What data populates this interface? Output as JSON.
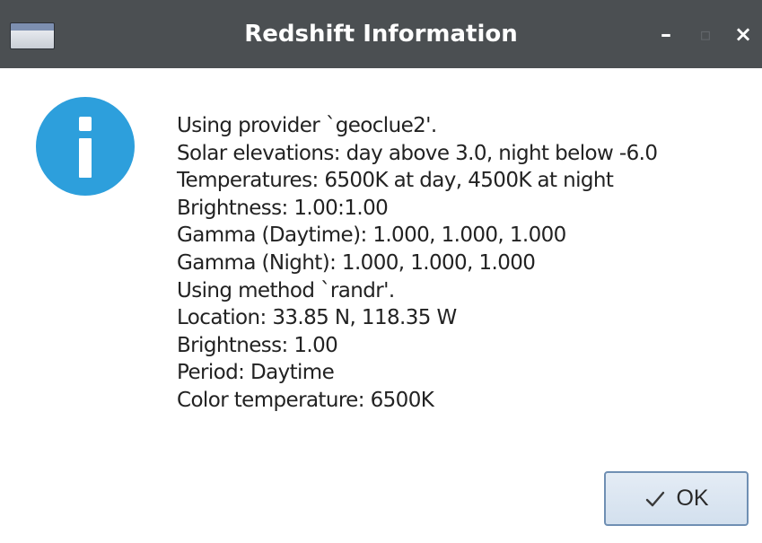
{
  "window": {
    "title": "Redshift Information",
    "app_icon": "window-icon",
    "controls": {
      "minimize": "–",
      "maximize": "▫",
      "close": "×"
    }
  },
  "dialog": {
    "icon": "info-icon",
    "lines": [
      "Using provider `geoclue2'.",
      "Solar elevations: day above 3.0, night below -6.0",
      "Temperatures: 6500K at day, 4500K at night",
      "Brightness: 1.00:1.00",
      "Gamma (Daytime): 1.000, 1.000, 1.000",
      "Gamma (Night): 1.000, 1.000, 1.000",
      "Using method `randr'.",
      "Location: 33.85 N, 118.35 W",
      "Brightness: 1.00",
      "Period: Daytime",
      "Color temperature: 6500K"
    ],
    "ok_button": {
      "label": "OK",
      "icon": "checkmark-icon"
    }
  },
  "colors": {
    "titlebar": "#4b4f52",
    "info_icon": "#2d9fdc",
    "button_border": "#6f8fb3"
  }
}
